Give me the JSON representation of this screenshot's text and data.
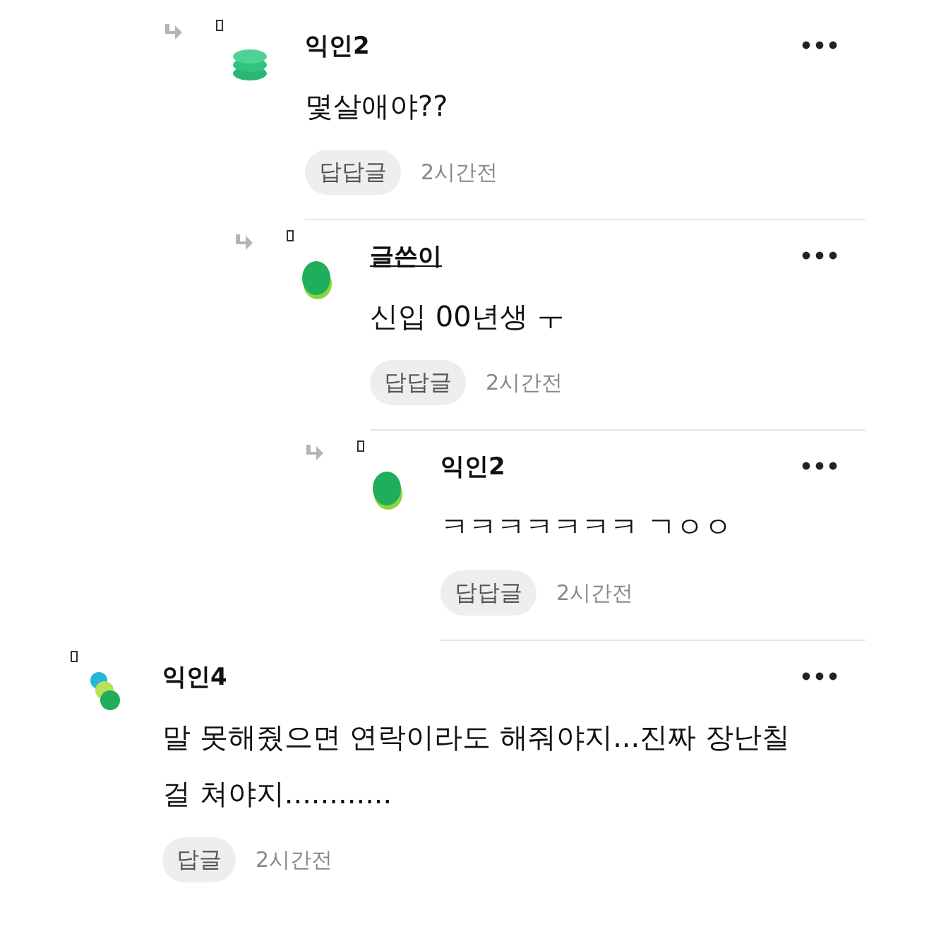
{
  "comments": [
    {
      "kind": "reply",
      "avatar": {
        "kind": "stack"
      },
      "author": "익인2",
      "is_writer": false,
      "text": "몇살애야??",
      "reply_label": "답답글",
      "time": "2시간전",
      "children": [
        {
          "kind": "reply",
          "avatar": {
            "kind": "blob"
          },
          "author": "글쓴이",
          "is_writer": true,
          "text": "신입 00년생 ㅜ",
          "reply_label": "답답글",
          "time": "2시간전",
          "children": [
            {
              "kind": "reply",
              "avatar": {
                "kind": "blob"
              },
              "author": "익인2",
              "is_writer": false,
              "text": "ㅋㅋㅋㅋㅋㅋㅋ ㄱㅇㅇ",
              "reply_label": "답답글",
              "time": "2시간전"
            }
          ]
        }
      ]
    },
    {
      "kind": "comment",
      "avatar": {
        "kind": "dots"
      },
      "author": "익인4",
      "is_writer": false,
      "text": "말 못해줬으면 연락이라도 해줘야지...진짜 장난칠 걸 쳐야지............",
      "reply_label": "답글",
      "time": "2시간전"
    }
  ]
}
